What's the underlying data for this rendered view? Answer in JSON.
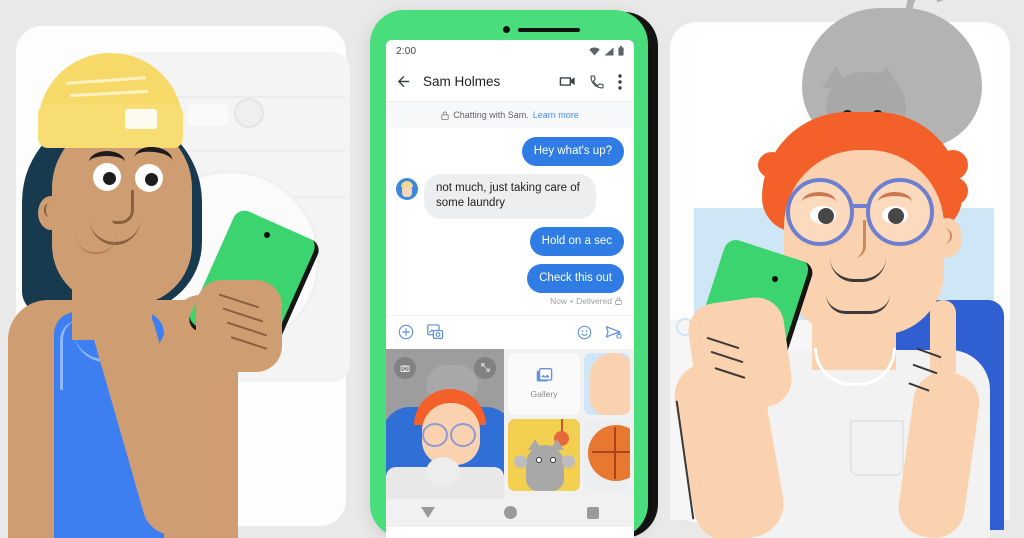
{
  "scene": {
    "description": "Google Messages RCS chat illustration",
    "background_color": "#e9e9e9"
  },
  "left_character": {
    "name": "woman-with-beanie",
    "beanie_color": "#f6d968",
    "hair_color": "#173a4f",
    "skin_color": "#cf9d72",
    "top_color": "#3d7ef0",
    "phone_color": "#3bd46f",
    "setting": "laundry room with washing machine, detergent bottles and basket"
  },
  "right_character": {
    "name": "man-with-cat-on-head",
    "hair_color": "#f4602a",
    "glasses_color": "#6e7fd0",
    "skin_color": "#fbd2b0",
    "shirt_color": "#f2f2f2",
    "cat_color": "#b3b3b3",
    "chair_color": "#2f5fd0",
    "phone_color": "#3bd46f"
  },
  "phone": {
    "frame_color": "#49dd7b",
    "shadow_color": "#141414",
    "status_bar": {
      "time": "2:00",
      "icons": [
        "wifi-icon",
        "signal-icon",
        "battery-icon"
      ]
    },
    "app_bar": {
      "back_label": "back-arrow",
      "title": "Sam Holmes",
      "actions": [
        "video-call-icon",
        "phone-call-icon",
        "overflow-menu-icon"
      ]
    },
    "banner": {
      "lock_icon": "lock-icon",
      "text": "Chatting with Sam.",
      "link": "Learn more",
      "link_color": "#4a8df0"
    },
    "messages": [
      {
        "direction": "out",
        "text": "Hey what's up?"
      },
      {
        "direction": "in",
        "text": "not much, just taking care of some laundry",
        "avatar": "sam-avatar"
      },
      {
        "direction": "out",
        "text": "Hold on a sec"
      },
      {
        "direction": "out",
        "text": "Check this out"
      }
    ],
    "message_status": {
      "time": "Now",
      "separator": "•",
      "state": "Delivered",
      "lock_icon": "lock-icon"
    },
    "bubble_colors": {
      "outgoing": "#2e7ce4",
      "outgoing_text": "#ffffff",
      "incoming": "#eceef0",
      "incoming_text": "#1f1f1f"
    },
    "composer": {
      "left_icons": [
        "plus-circle-icon",
        "gallery-camera-icon"
      ],
      "right_icons": [
        "emoji-icon",
        "send-icon"
      ]
    },
    "media_picker": {
      "camera_tile": {
        "name": "camera-viewfinder",
        "buttons": [
          "switch-camera-icon",
          "expand-icon"
        ]
      },
      "gallery_tile": {
        "label": "Gallery",
        "icon": "gallery-photos-icon"
      },
      "thumbnails": [
        "sky-finger-photo",
        "cat-on-yellow-photo",
        "basketball-photo"
      ]
    },
    "nav_bar": {
      "items": [
        "back-triangle",
        "home-circle",
        "recents-square"
      ]
    }
  }
}
